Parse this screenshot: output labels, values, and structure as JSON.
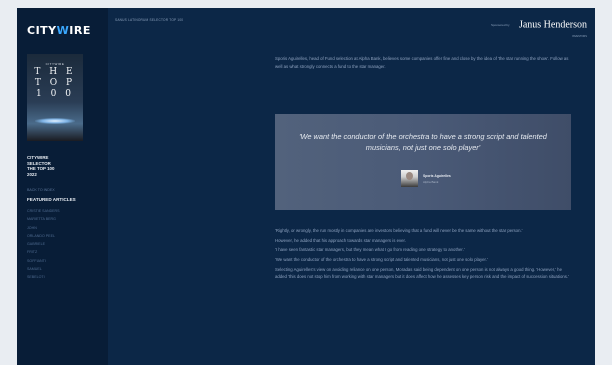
{
  "sidebar": {
    "logo": {
      "part1": "CITY",
      "part2": "W",
      "part3": "IRE"
    },
    "cover": {
      "small": "CITYWIRE",
      "big": [
        "T H E",
        "T O P",
        "1 0 0"
      ]
    },
    "title_lines": [
      "CITYWIRE",
      "SELECTOR",
      "THE TOP 100",
      "2022"
    ],
    "small_link": "BACK TO INDEX",
    "featured_heading": "FEATURED ARTICLES",
    "featured": [
      "CRISTIE SANDERS",
      "MARIETTA BERG",
      "JOHN",
      "ORLANDO PEEL",
      "GABRIELE",
      "FRITZ",
      "SOFFIANTI",
      "SAMUEL",
      "SEBELOTI"
    ]
  },
  "topbar": {
    "breadcrumb": "SANUS LATINORUM SELECTOR TOP 100",
    "sponsor_prefix": "Sponsored by",
    "sponsor_brand": "Janus Henderson",
    "sponsor_tag": "INVESTORS"
  },
  "intro": "Sporis Aguirelles, head of Fund selection at Alpha Bank, believes some companies offer fine and close by the idea of 'the star running the show'. Follow as well as what strongly connects a fund to the star manager.",
  "quote": {
    "text": "'We want the conductor of the orchestra to have a strong script and talented musicians, not just one solo player'",
    "name": "Sporis Aguirelles",
    "role": "Alpha Bank"
  },
  "paragraphs": [
    "'Rightly, or wrongly, the run mostly in companies are investors believing that a fund will never be the same without the star person.'",
    "However, he added that his approach towards star managers is ever.",
    "'I have seen fantastic star managers, but they mean what I go from reading one strategy to another.'",
    "'We want the conductor of the orchestra to have a strong script and talented musicians, not just one solo player.'",
    "Selecting Aguirelles's view on avoiding reliance on one person, Moradas said being dependent on one person is not always a good thing. 'However,' he added 'this does not stop him from working with star managers but it does affect how he assesses key person risk and the impact of succession situations.'"
  ]
}
